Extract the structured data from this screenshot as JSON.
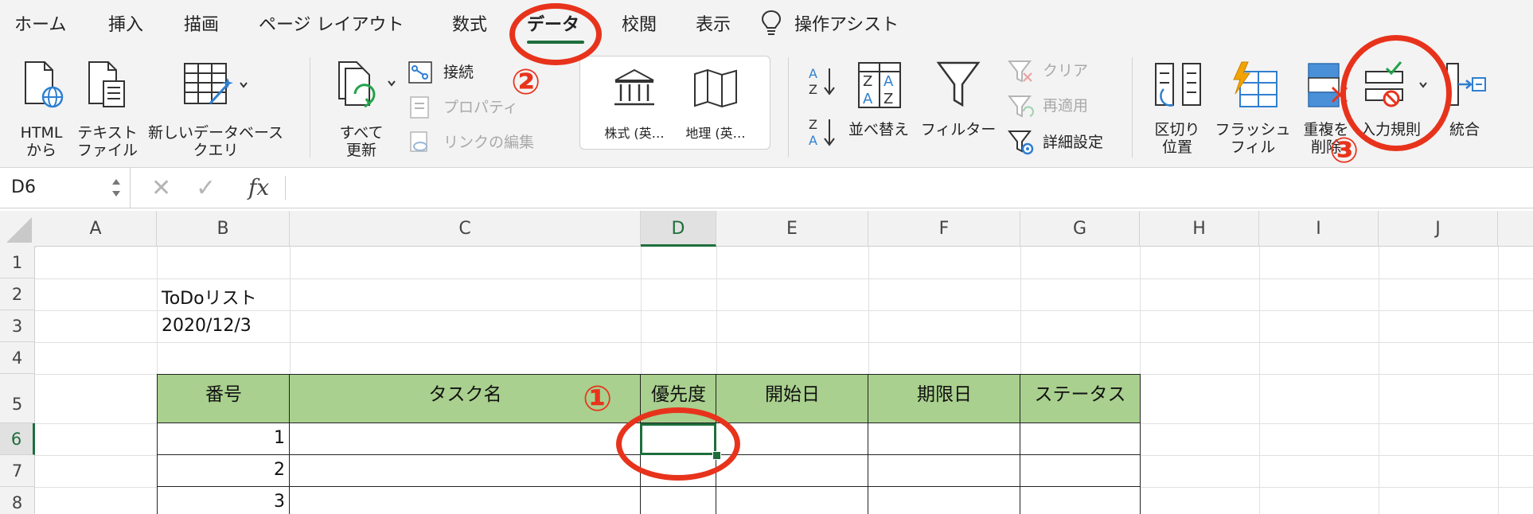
{
  "menu": {
    "tabs": [
      "ホーム",
      "挿入",
      "描画",
      "ページ レイアウト",
      "数式",
      "データ",
      "校閲",
      "表示"
    ],
    "active_tab": "データ",
    "assist_label": "操作アシスト"
  },
  "ribbon": {
    "html_line1": "HTML",
    "html_line2": "から",
    "text_line1": "テキスト",
    "text_line2": "ファイル",
    "newdb_line1": "新しいデータベース",
    "newdb_line2": "クエリ",
    "refresh_line1": "すべて",
    "refresh_line2": "更新",
    "connections": "接続",
    "properties": "プロパティ",
    "edit_links": "リンクの編集",
    "stocks": "株式 (英…",
    "geography": "地理 (英…",
    "sort": "並べ替え",
    "filter": "フィルター",
    "clear": "クリア",
    "reapply": "再適用",
    "advanced": "詳細設定",
    "split_line1": "区切り",
    "split_line2": "位置",
    "flash_line1": "フラッシュ",
    "flash_line2": "フィル",
    "dup_line1": "重複を",
    "dup_line2": "削除",
    "validation": "入力規則",
    "consolidate": "統合"
  },
  "formula_bar": {
    "name_box": "D6",
    "fx": "fx",
    "value": ""
  },
  "sheet": {
    "columns": [
      "A",
      "B",
      "C",
      "D",
      "E",
      "F",
      "G",
      "H",
      "I",
      "J"
    ],
    "rows": [
      "1",
      "2",
      "3",
      "4",
      "5",
      "6",
      "7",
      "8"
    ],
    "selected_column": "D",
    "selected_row": "6",
    "b2": "ToDoリスト",
    "b3": "2020/12/3",
    "table_headers": [
      "番号",
      "タスク名",
      "優先度",
      "開始日",
      "期限日",
      "ステータス"
    ],
    "numbers": [
      "1",
      "2",
      "3"
    ]
  },
  "annotations": {
    "step1": "①",
    "step2": "②",
    "step3": "③",
    "color": "#e8331c"
  },
  "colors": {
    "accent_green": "#1e6e3c",
    "table_header_fill": "#a9d08e",
    "ribbon_background": "#f3f3f3"
  }
}
